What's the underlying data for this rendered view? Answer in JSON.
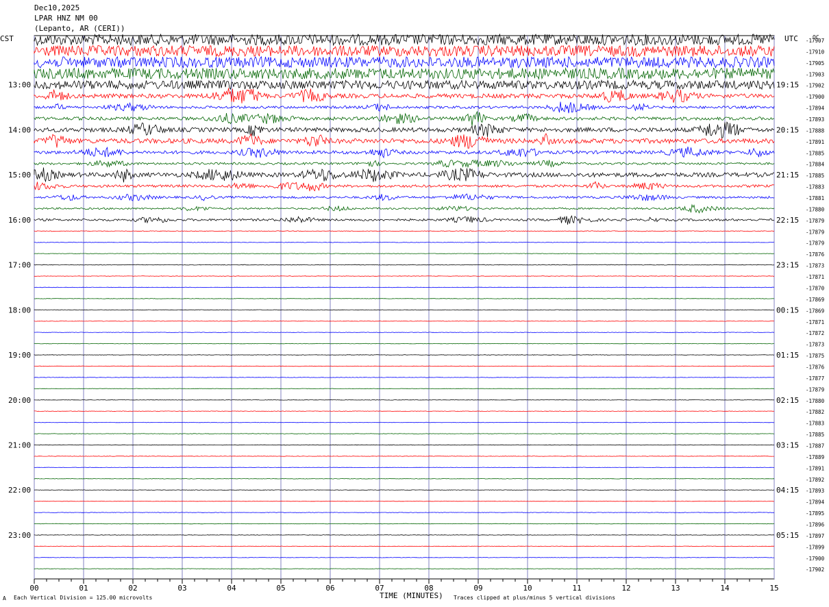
{
  "header": {
    "date": "Dec10,2025",
    "station": "LPAR HNZ NM 00",
    "location": "(Lepanto, AR (CERI))"
  },
  "left_zone": "CST",
  "right_zone": "UTC",
  "unit_label": "ОC",
  "footer": {
    "scale_note": "Each Vertical Division =  125.00 microvolts",
    "clip_note": "Traces clipped at plus/minus 5 vertical divisions",
    "corner_mark": "A"
  },
  "colors": {
    "black": "#000000",
    "red": "#ff0000",
    "blue": "#0000ff",
    "green": "#006400",
    "grid": "#8080c0"
  },
  "chart_data": {
    "type": "line",
    "title": "LPAR HNZ NM 00",
    "xlabel": "TIME (MINUTES)",
    "xlim": [
      0,
      15
    ],
    "x_ticks": [
      "00",
      "01",
      "02",
      "03",
      "04",
      "05",
      "06",
      "07",
      "08",
      "09",
      "10",
      "11",
      "12",
      "13",
      "14",
      "15"
    ],
    "left_time_labels": [
      "13:00",
      "14:00",
      "15:00",
      "16:00",
      "17:00",
      "18:00",
      "19:00",
      "20:00",
      "21:00",
      "22:00",
      "23:00"
    ],
    "right_time_labels": [
      "19:15",
      "20:15",
      "21:15",
      "22:15",
      "23:15",
      "00:15",
      "01:15",
      "02:15",
      "03:15",
      "04:15",
      "05:15"
    ],
    "trace_colors": [
      "black",
      "red",
      "blue",
      "green"
    ],
    "right_values": [
      "-17907",
      "-17910",
      "-17905",
      "-17903",
      "-17902",
      "-17900",
      "-17894",
      "-17893",
      "-17888",
      "-17891",
      "-17885",
      "-17884",
      "-17885",
      "-17883",
      "-17881",
      "-17880",
      "-17879",
      "-17879",
      "-17879",
      "-17876",
      "-17873",
      "-17871",
      "-17870",
      "-17869",
      "-17869",
      "-17871",
      "-17872",
      "-17873",
      "-17875",
      "-17876",
      "-17877",
      "-17879",
      "-17880",
      "-17882",
      "-17883",
      "-17885",
      "-17887",
      "-17889",
      "-17891",
      "-17892",
      "-17893",
      "-17894",
      "-17895",
      "-17896",
      "-17897",
      "-17899",
      "-17900",
      "-17902"
    ],
    "activity_levels": [
      5,
      5,
      5,
      5,
      4,
      2,
      1.2,
      1.5,
      2,
      2.2,
      1.5,
      1,
      2,
      1.2,
      1,
      0.8,
      1,
      0.3,
      0.25,
      0.2,
      0.25,
      0.2,
      0.2,
      0.2,
      0.2,
      0.2,
      0.2,
      0.2,
      0.2,
      0.2,
      0.2,
      0.2,
      0.2,
      0.2,
      0.2,
      0.2,
      0.2,
      0.2,
      0.2,
      0.2,
      0.2,
      0.2,
      0.2,
      0.2,
      0.2,
      0.2,
      0.2,
      0.2
    ]
  }
}
